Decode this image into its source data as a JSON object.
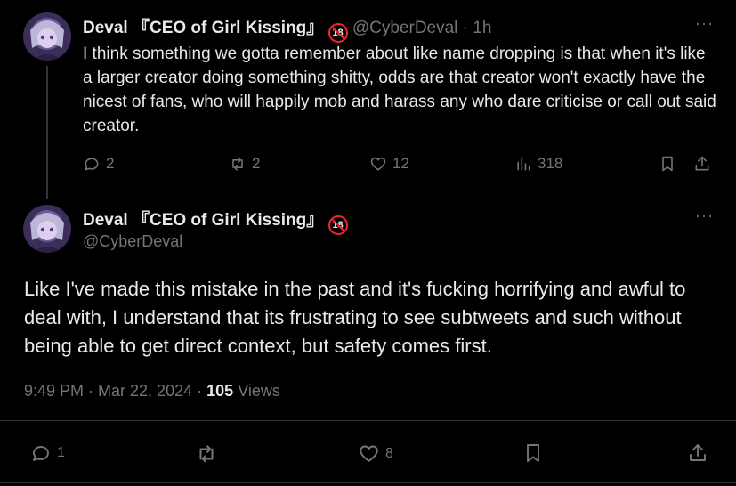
{
  "reply_tweet": {
    "display_name": "Deval 『CEO of Girl Kissing』",
    "badge": "18",
    "handle": "@CyberDeval",
    "separator": "·",
    "time": "1h",
    "text": "I think something we gotta remember about like name dropping is that when it's like a larger creator doing something shitty, odds are that creator won't exactly have the nicest of fans, who will happily mob and harass any who dare criticise or call out said creator.",
    "replies": "2",
    "reposts": "2",
    "likes": "12",
    "views": "318",
    "more": "···"
  },
  "main_tweet": {
    "display_name": "Deval 『CEO of Girl Kissing』",
    "badge": "18",
    "handle": "@CyberDeval",
    "text": "Like I've made this mistake in the past and it's fucking horrifying and awful to deal with, I understand that its frustrating to see subtweets and such without being able to get direct context, but safety comes first.",
    "timestamp": "9:49 PM · Mar 22, 2024",
    "dot": "·",
    "views_count": "105",
    "views_label": "Views",
    "replies": "1",
    "likes": "8",
    "more": "···"
  },
  "colors": {
    "background": "#000000",
    "text": "#e7e9ea",
    "muted": "#71767b",
    "badge_red": "#f4212e"
  },
  "icons": [
    "reply-icon",
    "repost-icon",
    "like-icon",
    "views-icon",
    "bookmark-icon",
    "share-icon"
  ]
}
